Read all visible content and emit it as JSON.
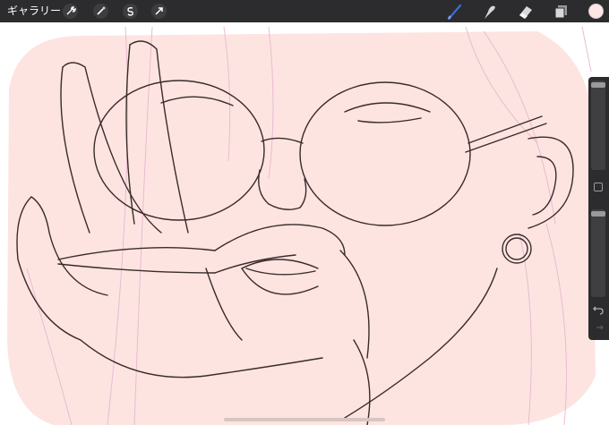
{
  "topbar": {
    "gallery_label": "ギャラリー",
    "actions": [
      "wrench-icon",
      "magic-wand-icon",
      "selection-icon",
      "transform-arrow-icon"
    ],
    "tools": [
      "brush-icon",
      "smudge-icon",
      "eraser-icon",
      "layers-icon"
    ],
    "active_tool": "brush-icon",
    "active_tool_color": "#3d6bd9",
    "current_color": "#fde6e4"
  },
  "canvas": {
    "fill_color": "#fde4e1",
    "line_color": "#3a2a2a",
    "sketch_color": "#e8bcd0"
  },
  "sidebar": {
    "controls": [
      "brush-size-slider",
      "modify-button",
      "opacity-slider",
      "undo-icon",
      "redo-icon"
    ],
    "brush_size": 1.0,
    "opacity": 1.0
  }
}
